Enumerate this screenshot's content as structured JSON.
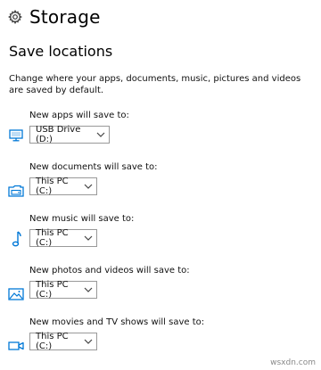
{
  "header": {
    "title": "Storage",
    "icon": "gear-icon"
  },
  "section": {
    "title": "Save locations",
    "description": "Change where your apps, documents, music, pictures and videos are saved by default."
  },
  "locations": [
    {
      "label": "New apps will save to:",
      "value": "USB Drive (D:)",
      "icon": "monitor-icon"
    },
    {
      "label": "New documents will save to:",
      "value": "This PC (C:)",
      "icon": "folder-drive-icon"
    },
    {
      "label": "New music will save to:",
      "value": "This PC (C:)",
      "icon": "music-note-icon"
    },
    {
      "label": "New photos and videos will save to:",
      "value": "This PC (C:)",
      "icon": "picture-icon"
    },
    {
      "label": "New movies and TV shows will save to:",
      "value": "This PC (C:)",
      "icon": "video-camera-icon"
    }
  ],
  "watermark": "wsxdn.com",
  "colors": {
    "accent": "#0078d7",
    "border": "#999999"
  }
}
